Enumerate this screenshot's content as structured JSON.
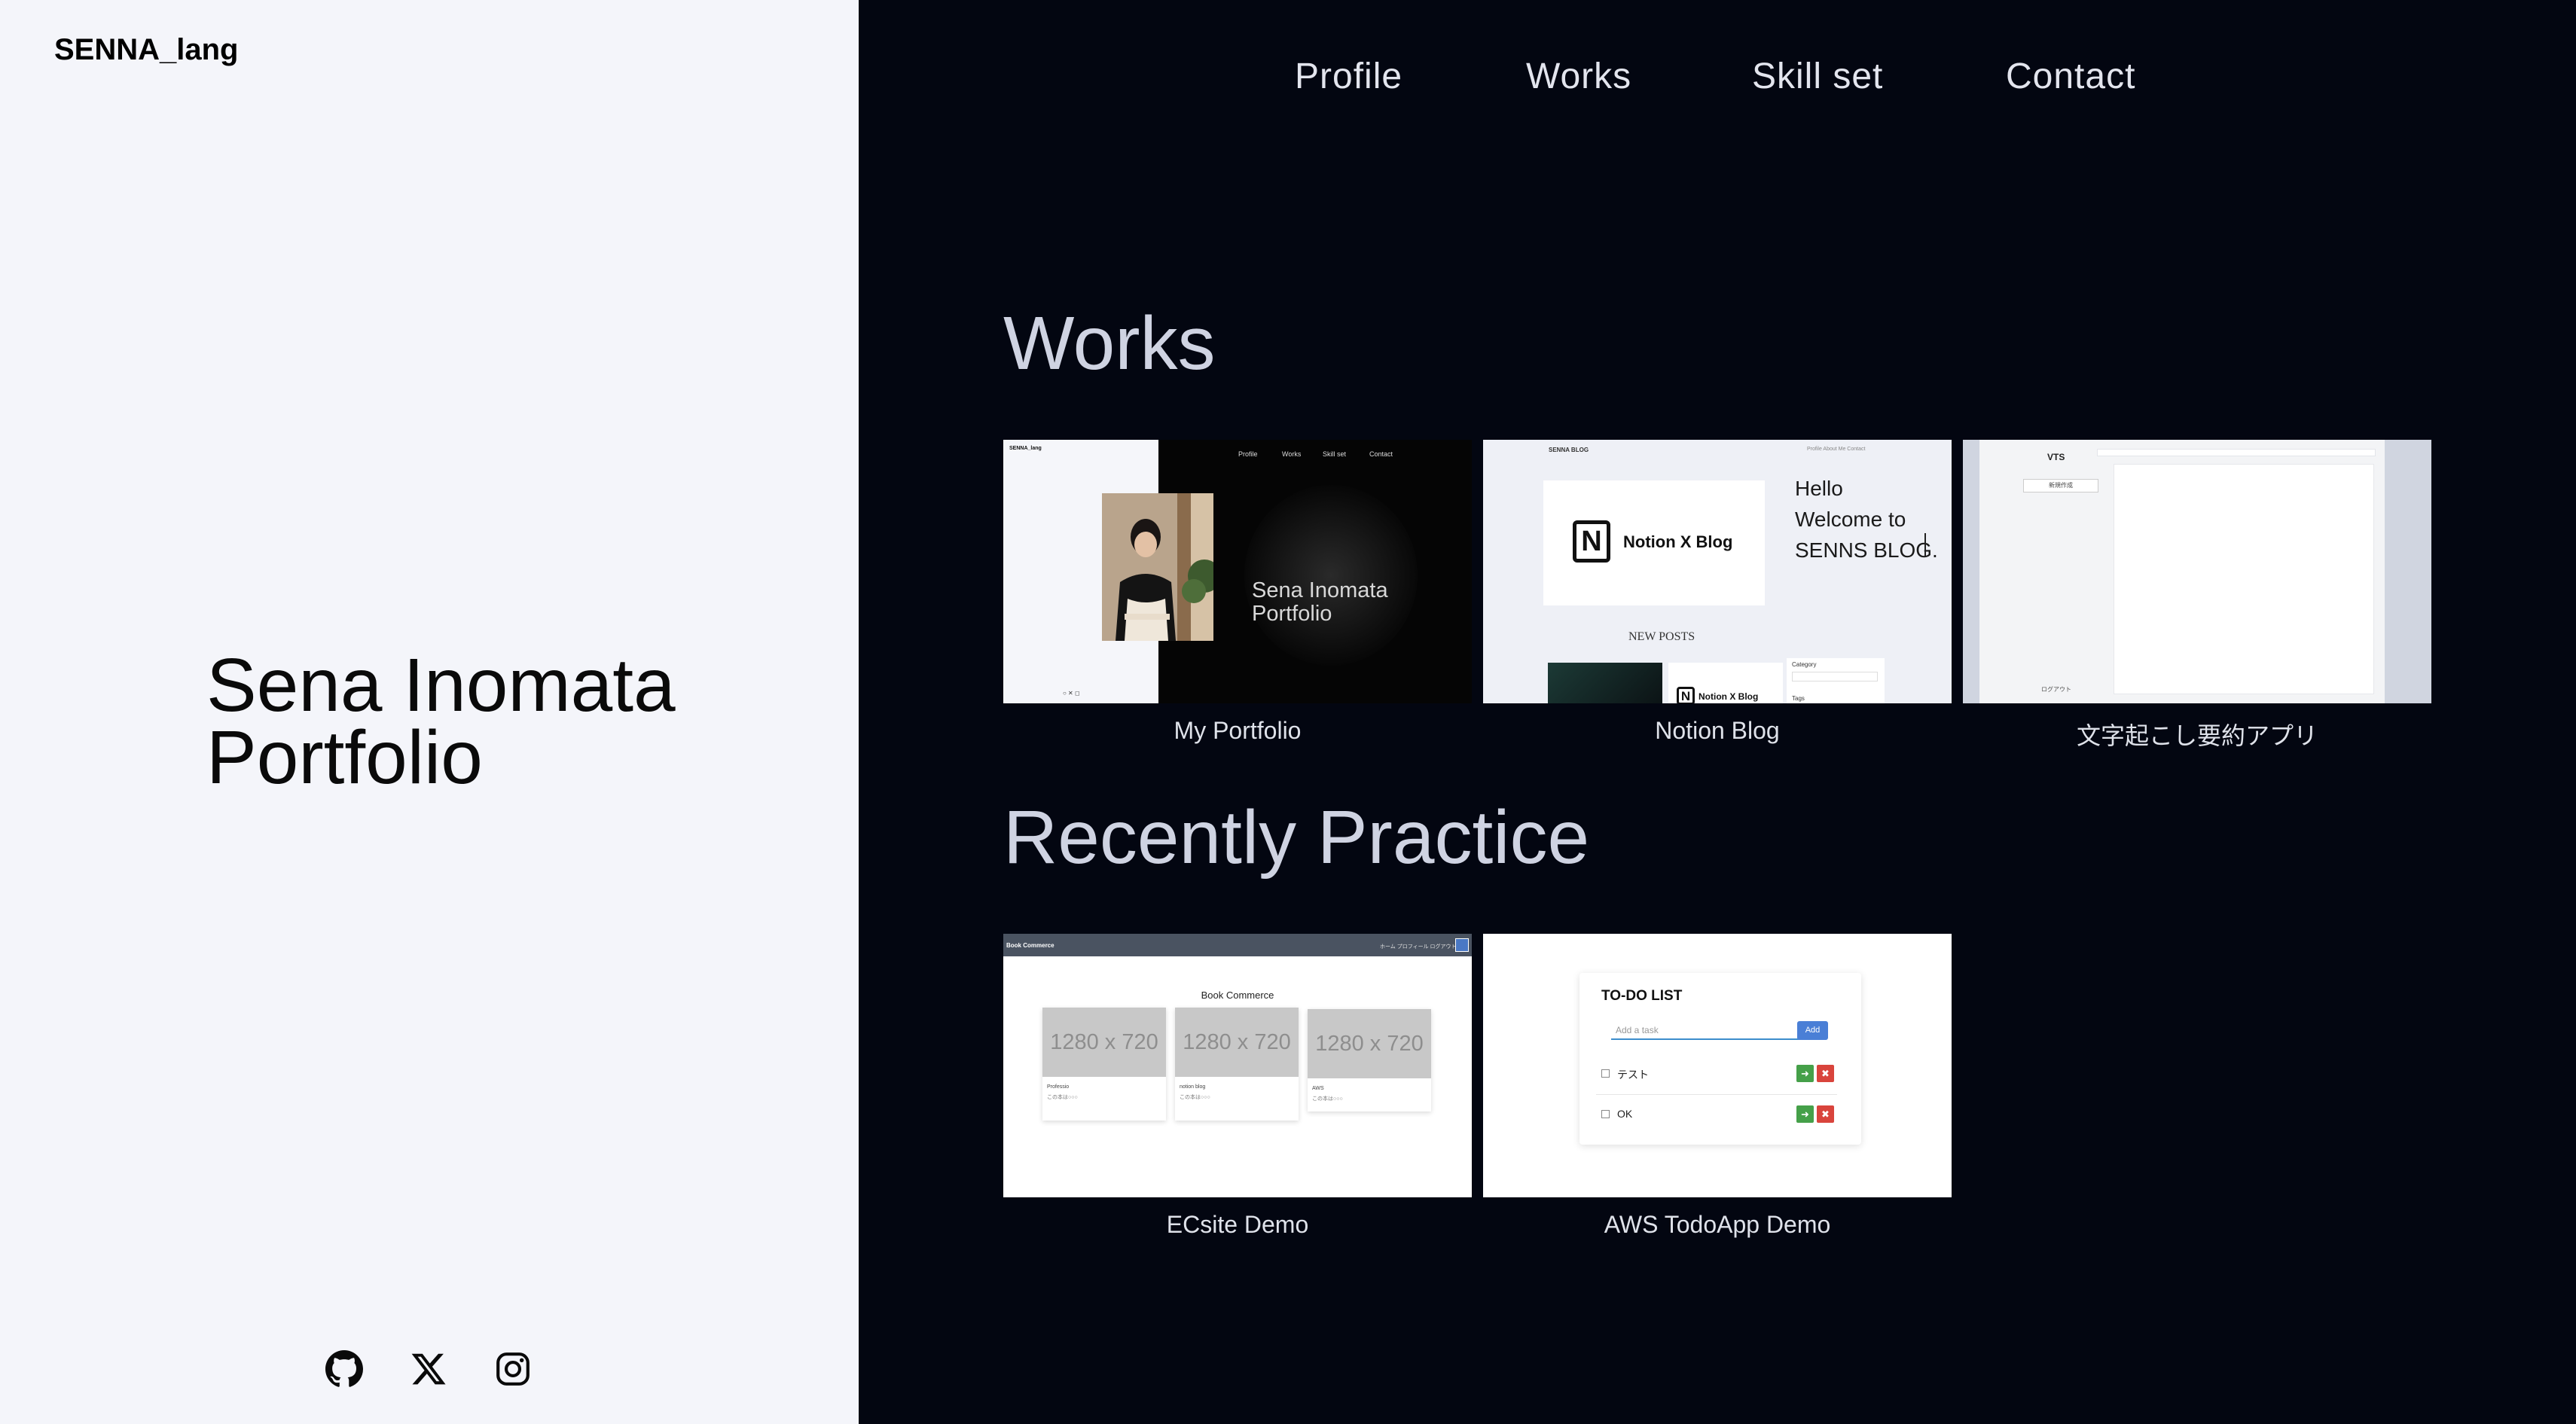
{
  "brand": {
    "logo": "SENNA_lang"
  },
  "hero": {
    "line1": "Sena Inomata",
    "line2": "Portfolio"
  },
  "social": [
    {
      "icon": "github-icon"
    },
    {
      "icon": "x-icon"
    },
    {
      "icon": "instagram-icon"
    }
  ],
  "nav": {
    "profile": "Profile",
    "works": "Works",
    "skill": "Skill set",
    "contact": "Contact"
  },
  "works": {
    "title": "Works",
    "items": [
      {
        "caption": "My Portfolio",
        "thumb": {
          "logo": "SENNA_lang",
          "nav": [
            "Profile",
            "Works",
            "Skill set",
            "Contact"
          ],
          "title1": "Sena Inomata",
          "title2": "Portfolio"
        }
      },
      {
        "caption": "Notion Blog",
        "thumb": {
          "brand": "SENNA BLOG",
          "nav": "Profile  About Me  Contact",
          "card_label": "Notion X Blog",
          "hello1": "Hello",
          "hello2": "Welcome to",
          "hello3": "SENNS BLOG.",
          "new_posts": "NEW POSTS",
          "post_label": "Notion X Blog",
          "category": "Category",
          "tags": "Tags"
        }
      },
      {
        "caption": "文字起こし要約アプリ",
        "thumb": {
          "brand": "VTS",
          "new_chat": "新規作成",
          "logout": "ログアウト"
        }
      }
    ]
  },
  "practice": {
    "title": "Recently Practice",
    "items": [
      {
        "caption": "ECsite Demo",
        "thumb": {
          "brand": "Book Commerce",
          "nav": "ホーム   プロフィール   ログアウト",
          "heading": "Book Commerce",
          "placeholder": "1280 x 720",
          "books": [
            {
              "title": "Professio",
              "line2": "この本は○○○"
            },
            {
              "title": "notion blog",
              "line2": "この本は○○○"
            },
            {
              "title": "AWS",
              "line2": "この本は○○○"
            }
          ]
        }
      },
      {
        "caption": "AWS TodoApp Demo",
        "thumb": {
          "title": "TO-DO LIST",
          "placeholder": "Add a task",
          "add": "Add",
          "tasks": [
            "テスト",
            "OK"
          ]
        }
      }
    ]
  },
  "colors": {
    "left_bg": "#f4f5fa",
    "right_bg": "#030611",
    "heading": "#cfd3e2",
    "nav_text": "#e3e5ee"
  }
}
